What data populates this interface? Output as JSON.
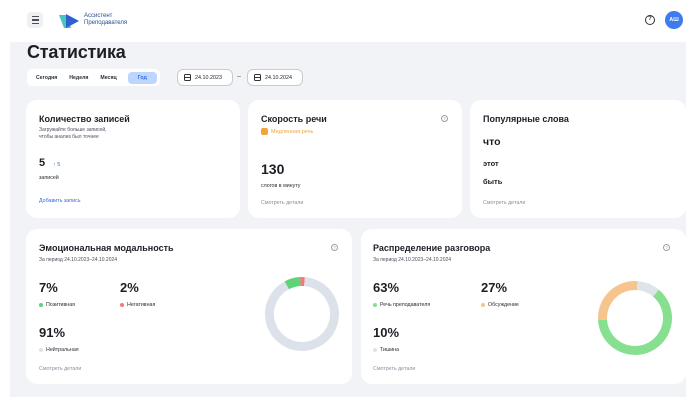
{
  "header": {
    "brand_line1": "Ассистент",
    "brand_line2": "Преподавателя",
    "help_icon": "?",
    "avatar_initials": "АШ"
  },
  "page": {
    "title": "Статистика"
  },
  "filters": {
    "periods": [
      "Сегодня",
      "Неделя",
      "Месяц",
      "Год"
    ],
    "active_period": "Год",
    "date_from": "24.10.2023",
    "date_to": "24.10.2024",
    "separator": "–"
  },
  "records": {
    "title": "Количество записей",
    "hint_line1": "Загружайте больше записей,",
    "hint_line2": "чтобы анализ был точнее",
    "count": "5",
    "delta": "↑ 5",
    "unit": "записей",
    "add_link": "Добавить запись"
  },
  "speed": {
    "title": "Скорость речи",
    "status": "Медленная речь",
    "value": "130",
    "unit": "слогов в минуту",
    "details": "Смотреть детали"
  },
  "words": {
    "title": "Популярные слова",
    "items": [
      "что",
      "этот",
      "быть"
    ],
    "details": "Смотреть детали"
  },
  "emotion": {
    "title": "Эмоциональная модальность",
    "period": "За период 24.10.2023–24.10.2024",
    "positive_value": "7%",
    "positive_label": "Позитивная",
    "negative_value": "2%",
    "negative_label": "Негативная",
    "neutral_value": "91%",
    "neutral_label": "Нейтральная",
    "details": "Смотреть детали"
  },
  "conversation": {
    "title": "Распределение разговора",
    "period": "За период 24.10.2023–24.10.2024",
    "teacher_value": "63%",
    "teacher_label": "Речь преподавателя",
    "discussion_value": "27%",
    "discussion_label": "Обсуждение",
    "silence_value": "10%",
    "silence_label": "Тишина",
    "details": "Смотреть детали"
  },
  "colors": {
    "accent": "#2f6fe0",
    "positive": "#5fd27a",
    "negative": "#f07a7a",
    "neutral": "#dde2ea",
    "teacher": "#86e08f",
    "discussion": "#f6c48d",
    "silence": "#dfe3ea"
  },
  "chart_data": [
    {
      "type": "pie",
      "categories": [
        "Позитивная",
        "Негативная",
        "Нейтральная"
      ],
      "values": [
        7,
        2,
        91
      ]
    },
    {
      "type": "pie",
      "categories": [
        "Речь преподавателя",
        "Обсуждение",
        "Тишина"
      ],
      "values": [
        63,
        27,
        10
      ]
    }
  ]
}
